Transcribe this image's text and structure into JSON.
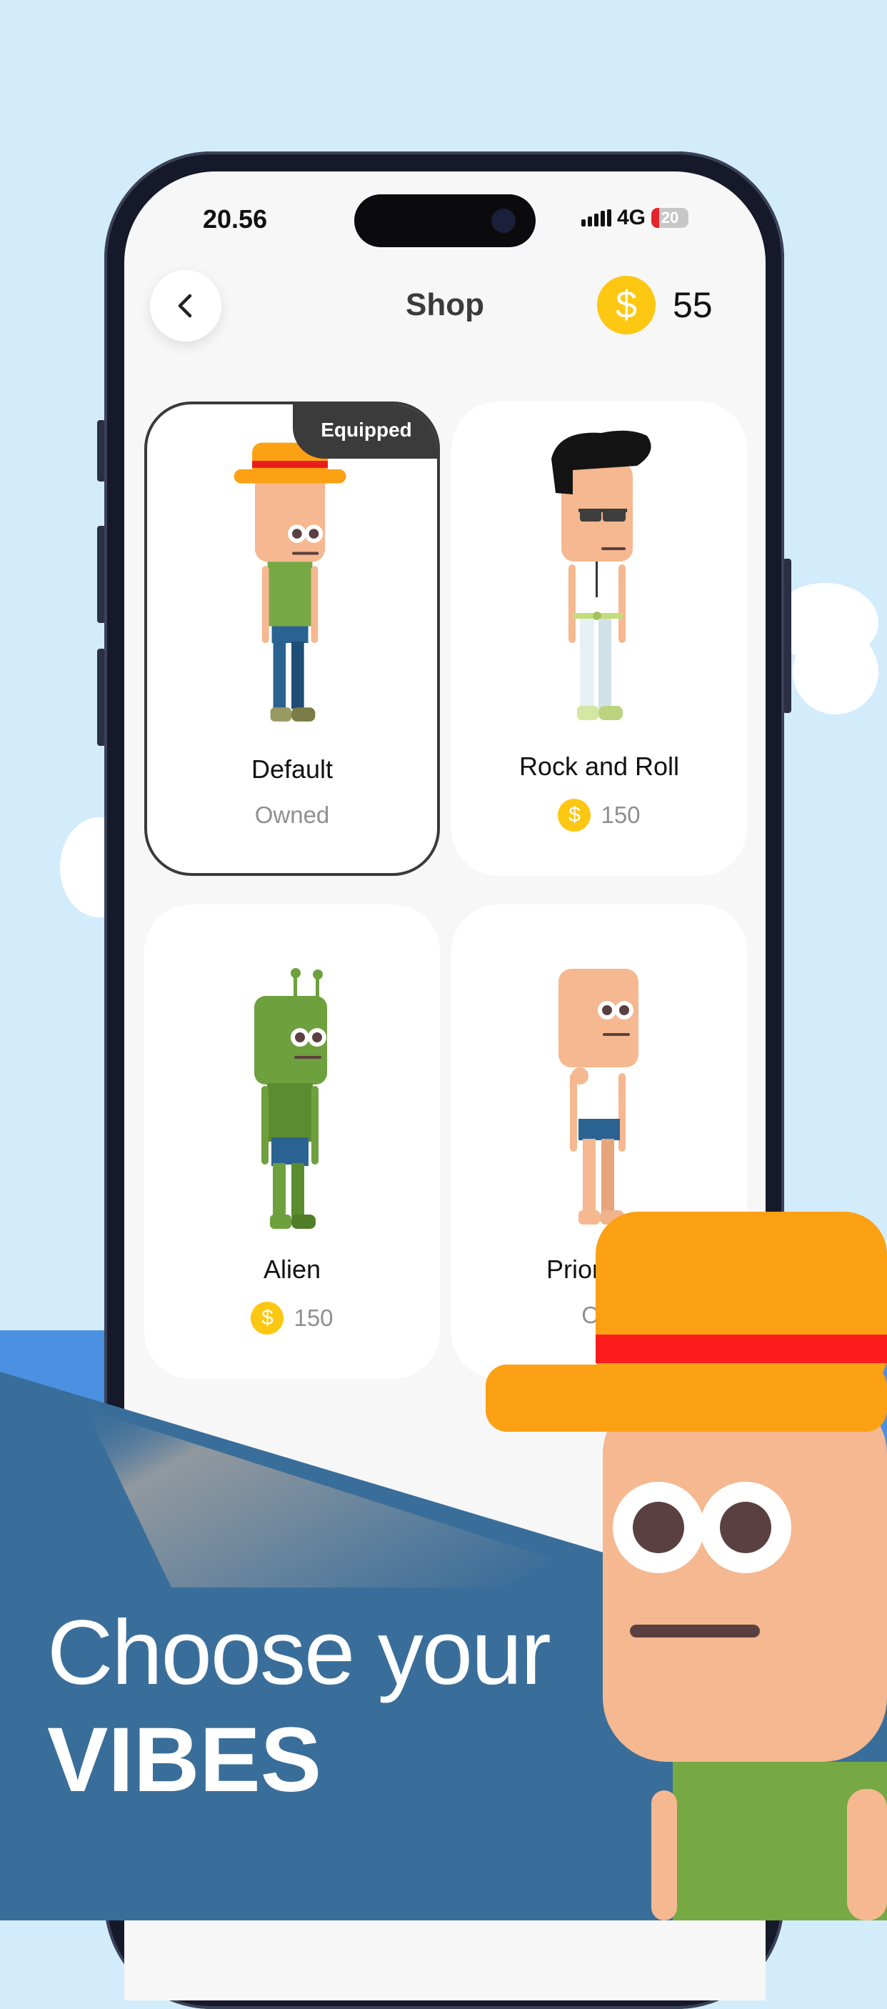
{
  "status_bar": {
    "time": "20.56",
    "network": "4G",
    "battery": "20"
  },
  "header": {
    "title": "Shop",
    "coins": "55"
  },
  "items": [
    {
      "name": "Default",
      "status": "Owned",
      "badge": "Equipped"
    },
    {
      "name": "Rock and Roll",
      "price": "150"
    },
    {
      "name": "Alien",
      "price": "150"
    },
    {
      "name": "Priority C",
      "status": "Ow"
    }
  ],
  "promo": {
    "line1": "Choose your",
    "line2": "VIBES"
  },
  "colors": {
    "coin": "#fdc712",
    "sky": "#d3ecfc",
    "banner": "#3a6e9a",
    "hat": "#fca014"
  },
  "icons": {
    "back": "chevron-left-icon",
    "coin": "dollar-coin-icon",
    "signal": "signal-bars-icon",
    "battery": "battery-icon"
  }
}
